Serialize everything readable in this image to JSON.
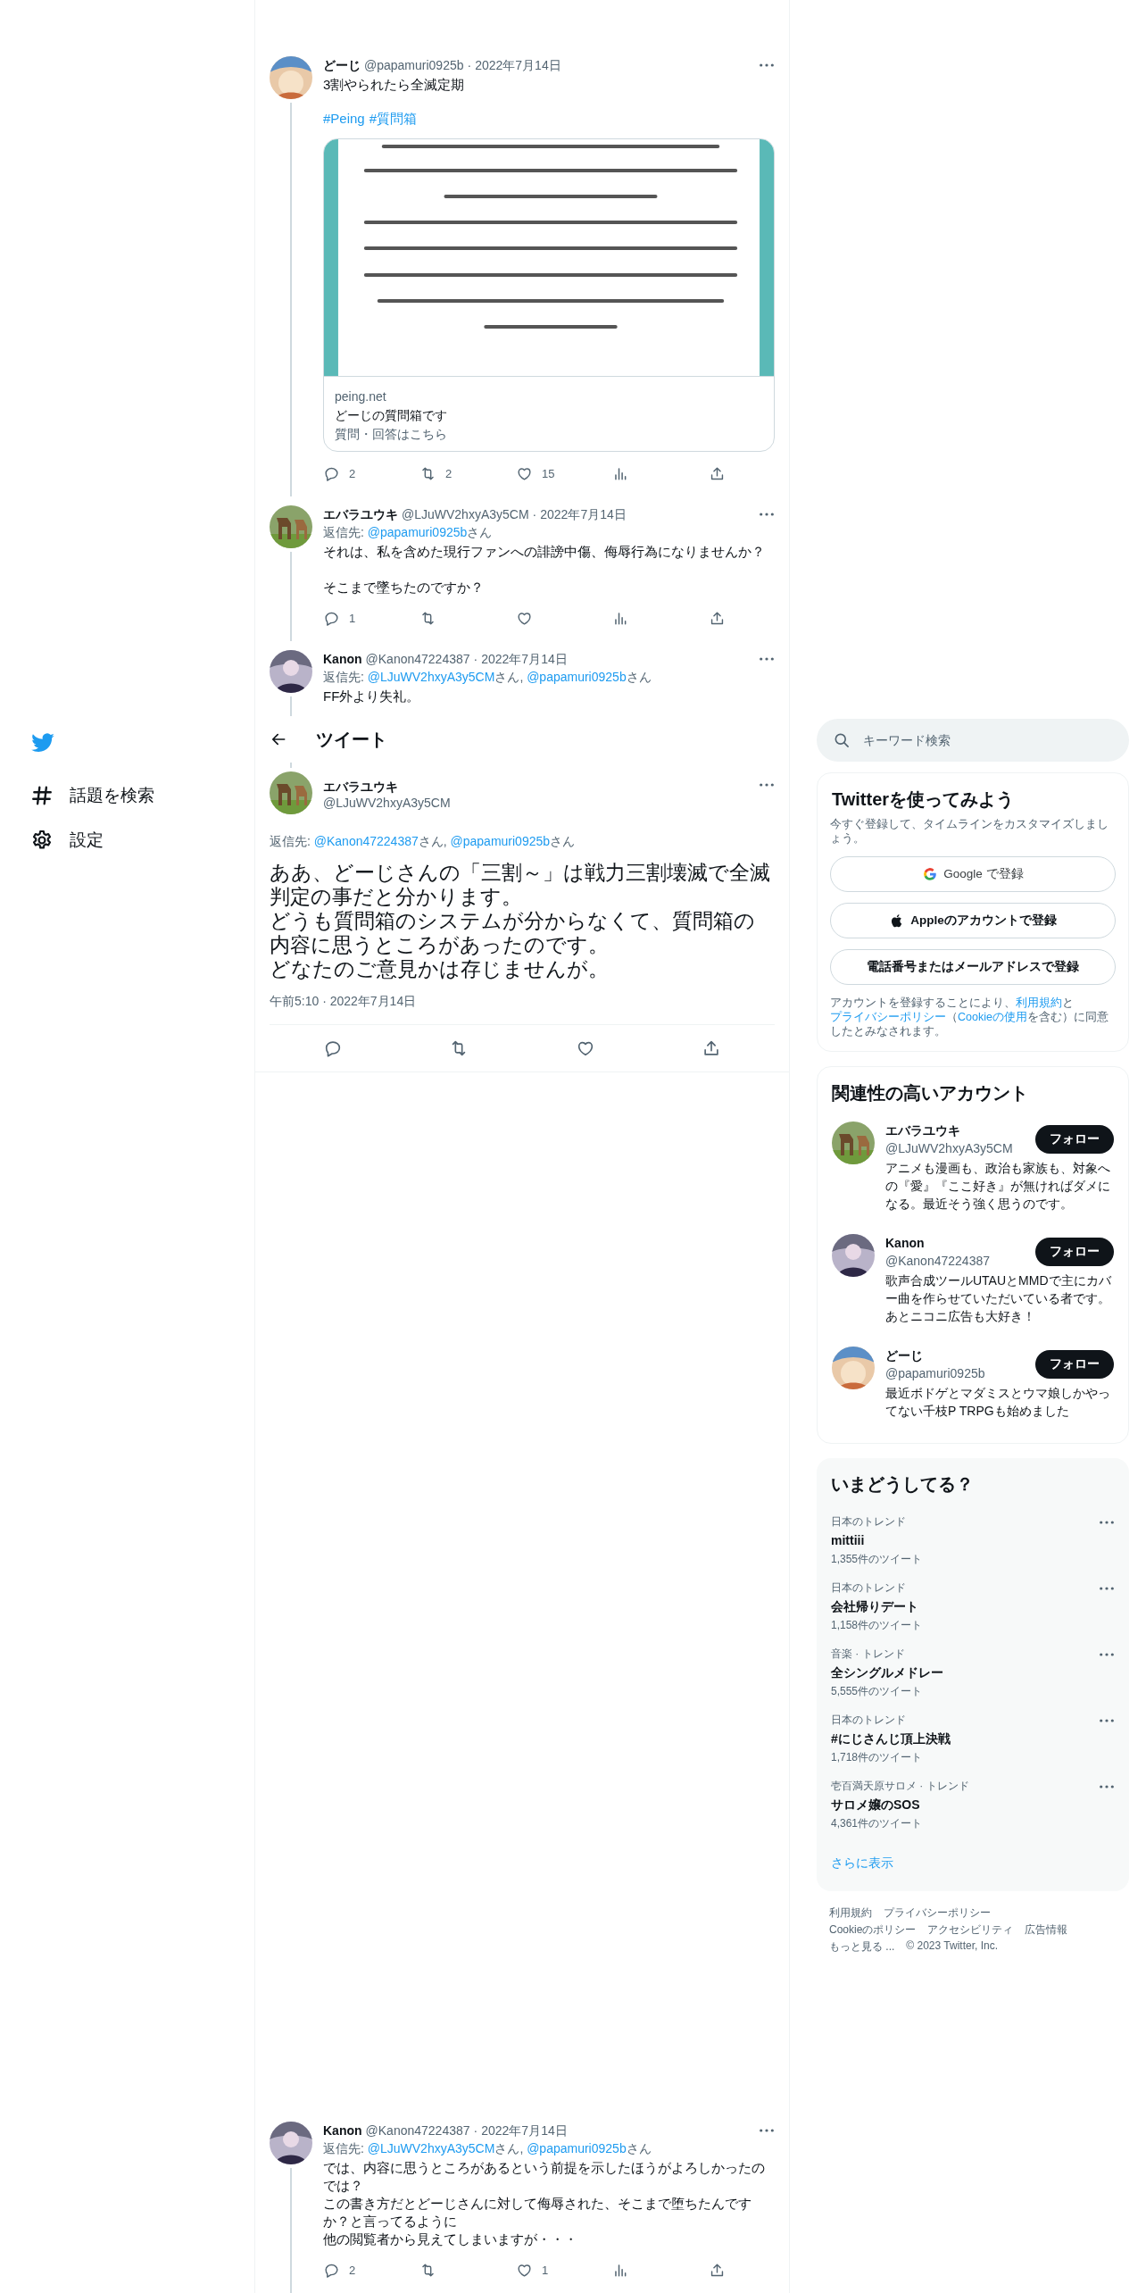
{
  "sidebar": {
    "items": [
      {
        "kind": "explore",
        "label": "話題を検索"
      },
      {
        "kind": "settings",
        "label": "設定"
      }
    ]
  },
  "thread": [
    {
      "name": "どーじ",
      "handle": "@papamuri0925b",
      "separator": "·",
      "date": "2022年7月14日",
      "text": [
        [
          "3割やられたら全滅定期"
        ]
      ],
      "hashtags": [
        "#Peing",
        "#質問箱"
      ],
      "card": {
        "kind": "picture",
        "domain": "peing.net",
        "title": "どーじの質問箱です",
        "description": "質問・回答はこちら"
      },
      "actions": [
        {
          "kind": "reply",
          "count": "2"
        },
        {
          "kind": "retweet",
          "count": "2"
        },
        {
          "kind": "like",
          "count": "15"
        },
        {
          "kind": "views"
        },
        {
          "kind": "share"
        }
      ]
    },
    {
      "name": "エバラユウキ",
      "handle": "@LJuWV2hxyA3y5CM",
      "separator": "·",
      "date": "2022年7月14日",
      "reply_to": {
        "label": "返信先:",
        "parts": [
          {
            "kind": "link",
            "text": "@papamuri0925b"
          },
          {
            "kind": "plain",
            "text": "さん"
          }
        ]
      },
      "text": [
        [
          "それは、私を含めた現行ファンへの誹謗中傷、侮辱行為になりませんか？"
        ],
        [
          "そこまで墜ちたのですか？"
        ]
      ],
      "actions": [
        {
          "kind": "reply",
          "count": "1"
        },
        {
          "kind": "retweet"
        },
        {
          "kind": "like"
        },
        {
          "kind": "views"
        },
        {
          "kind": "share"
        }
      ]
    },
    {
      "name": "Kanon",
      "handle": "@Kanon47224387",
      "separator": "·",
      "date": "2022年7月14日",
      "reply_to": {
        "label": "返信先:",
        "parts": [
          {
            "kind": "link",
            "text": "@LJuWV2hxyA3y5CM"
          },
          {
            "kind": "plain",
            "text": "さん, "
          },
          {
            "kind": "link",
            "text": "@papamuri0925b"
          },
          {
            "kind": "plain",
            "text": "さん"
          }
        ]
      },
      "text": [
        [
          "FF外より失礼。"
        ]
      ]
    }
  ],
  "header": {
    "title": "ツイート"
  },
  "main_tweet": {
    "name": "エバラユウキ",
    "handle": "@LJuWV2hxyA3y5CM",
    "reply_to": {
      "label": "返信先:",
      "parts": [
        {
          "kind": "link",
          "text": "@Kanon47224387"
        },
        {
          "kind": "plain",
          "text": "さん, "
        },
        {
          "kind": "link",
          "text": "@papamuri0925b"
        },
        {
          "kind": "plain",
          "text": "さん"
        }
      ]
    },
    "text": [
      "ああ、どーじさんの「三割～」は戦力三割壊滅で全滅",
      "判定の事だと分かります。",
      "どうも質問箱のシステムが分からなくて、質問箱の",
      "内容に思うところがあったのです。",
      "どなたのご意見かは存じませんが。"
    ],
    "timestamp": "午前5:10 · 2022年7月14日",
    "actions": [
      {
        "kind": "reply"
      },
      {
        "kind": "retweet"
      },
      {
        "kind": "like"
      },
      {
        "kind": "share"
      }
    ]
  },
  "replies": [
    {
      "name": "Kanon",
      "handle": "@Kanon47224387",
      "separator": "·",
      "date": "2022年7月14日",
      "reply_to": {
        "label": "返信先:",
        "parts": [
          {
            "kind": "link",
            "text": "@LJuWV2hxyA3y5CM"
          },
          {
            "kind": "plain",
            "text": "さん, "
          },
          {
            "kind": "link",
            "text": "@papamuri0925b"
          },
          {
            "kind": "plain",
            "text": "さん"
          }
        ]
      },
      "text": [
        [
          "では、内容に思うところがあるという前提を示したほうがよろしかったの",
          "では？",
          "この書き方だとどーじさんに対して侮辱された、そこまで堕ちたんです",
          "か？と言ってるように",
          "他の閲覧者から見えてしまいますが・・・"
        ]
      ],
      "actions": [
        {
          "kind": "reply",
          "count": "2"
        },
        {
          "kind": "retweet"
        },
        {
          "kind": "like",
          "count": "1"
        },
        {
          "kind": "views"
        },
        {
          "kind": "share"
        }
      ]
    }
  ],
  "search": {
    "placeholder": "キーワード検索"
  },
  "signup": {
    "title": "Twitterを使ってみよう",
    "subtitle": "今すぐ登録して、タイムラインをカスタマイズしましょう。",
    "buttons": [
      {
        "kind": "google",
        "label": "Google で登録"
      },
      {
        "kind": "apple",
        "label": "Appleのアカウントで登録"
      },
      {
        "kind": "phone",
        "label": "電話番号またはメールアドレスで登録"
      }
    ],
    "legal": [
      {
        "kind": "plain",
        "text": "アカウントを登録することにより、"
      },
      {
        "kind": "link",
        "text": "利用規約"
      },
      {
        "kind": "plain",
        "text": "と"
      },
      {
        "kind": "link",
        "text": "プライバシーポリシー"
      },
      {
        "kind": "plain",
        "text": "（"
      },
      {
        "kind": "link",
        "text": "Cookieの使用"
      },
      {
        "kind": "plain",
        "text": "を含む）に同意したとみなされます。"
      }
    ]
  },
  "who_to_follow": {
    "title": "関連性の高いアカウント",
    "accounts": [
      {
        "name": "エバラユウキ",
        "handle": "@LJuWV2hxyA3y5CM",
        "bio": "アニメも漫画も、政治も家族も、対象への『愛』『ここ好き』が無ければダメになる。最近そう強く思うのです。",
        "button": "フォロー"
      },
      {
        "name": "Kanon",
        "handle": "@Kanon47224387",
        "bio": "歌声合成ツールUTAUとMMDで主にカバー曲を作らせていただいている者です。あとニコニ広告も大好き！",
        "button": "フォロー"
      },
      {
        "name": "どーじ",
        "handle": "@papamuri0925b",
        "bio": "最近ボドゲとマダミスとウマ娘しかやってない千枝P TRPGも始めました",
        "button": "フォロー"
      }
    ]
  },
  "trends": {
    "title": "いまどうしてる？",
    "items": [
      {
        "context": "日本のトレンド",
        "name": "mittiii",
        "count": "1,355件のツイート"
      },
      {
        "context": "日本のトレンド",
        "name": "会社帰りデート",
        "count": "1,158件のツイート"
      },
      {
        "context": "音楽 · トレンド",
        "name": "全シングルメドレー",
        "count": "5,555件のツイート"
      },
      {
        "context": "日本のトレンド",
        "name": "#にじさんじ頂上決戦",
        "count": "1,718件のツイート"
      },
      {
        "context": "壱百満天原サロメ · トレンド",
        "name": "サロメ嬢のSOS",
        "count": "4,361件のツイート"
      }
    ],
    "more": "さらに表示"
  },
  "footer": {
    "links": [
      "利用規約",
      "プライバシーポリシー",
      "Cookieのポリシー",
      "アクセシビリティ",
      "広告情報",
      "もっと見る ...",
      "© 2023 Twitter, Inc."
    ]
  }
}
